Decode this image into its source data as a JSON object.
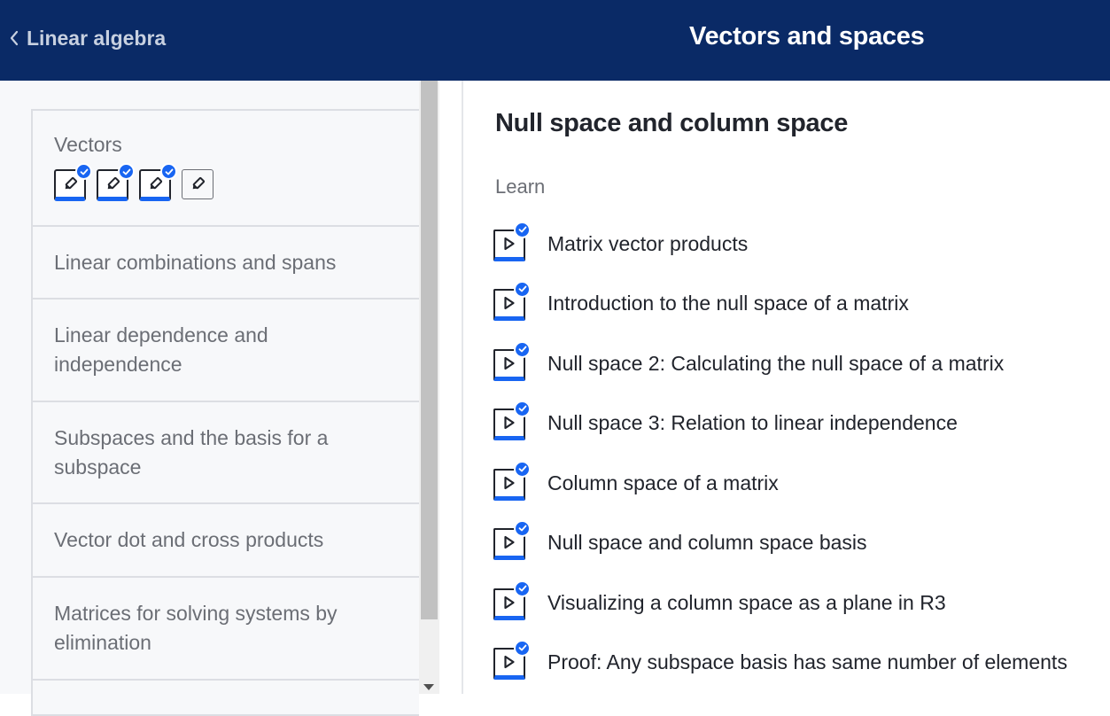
{
  "header": {
    "back_label": "Linear algebra",
    "title": "Vectors and spaces",
    "background_color": "#0a2a66"
  },
  "sidebar": {
    "units": [
      {
        "label": "Vectors",
        "exercises": [
          {
            "icon": "pencil-icon",
            "completed": true
          },
          {
            "icon": "pencil-icon",
            "completed": true
          },
          {
            "icon": "pencil-icon",
            "completed": true
          },
          {
            "icon": "pencil-icon",
            "completed": false
          }
        ]
      },
      {
        "label": "Linear combinations and spans"
      },
      {
        "label": "Linear dependence and independence"
      },
      {
        "label": "Subspaces and the basis for a subspace"
      },
      {
        "label": "Vector dot and cross products"
      },
      {
        "label": "Matrices for solving systems by elimination"
      },
      {
        "label": ""
      }
    ]
  },
  "main": {
    "section_title": "Null space and column space",
    "learn_label": "Learn",
    "videos": [
      {
        "label": "Matrix vector products",
        "icon": "play-icon",
        "completed": true
      },
      {
        "label": "Introduction to the null space of a matrix",
        "icon": "play-icon",
        "completed": true
      },
      {
        "label": "Null space 2: Calculating the null space of a matrix",
        "icon": "play-icon",
        "completed": true
      },
      {
        "label": "Null space 3: Relation to linear independence",
        "icon": "play-icon",
        "completed": true
      },
      {
        "label": "Column space of a matrix",
        "icon": "play-icon",
        "completed": true
      },
      {
        "label": "Null space and column space basis",
        "icon": "play-icon",
        "completed": true
      },
      {
        "label": "Visualizing a column space as a plane in R3",
        "icon": "play-icon",
        "completed": true
      },
      {
        "label": "Proof: Any subspace basis has same number of elements",
        "icon": "play-icon",
        "completed": true
      }
    ]
  },
  "colors": {
    "accent": "#1865f2",
    "sidebar_bg": "#f7f8fa",
    "muted_text": "#6b6e75"
  }
}
